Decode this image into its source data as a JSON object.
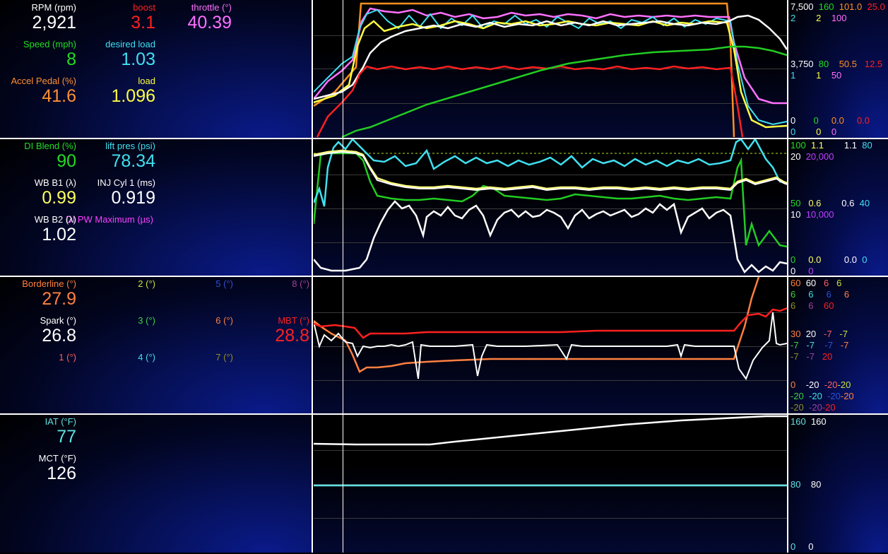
{
  "panel1": {
    "gauges": [
      {
        "label": "RPM (rpm)",
        "value": "2,921",
        "color": "#ffffff"
      },
      {
        "label": "boost",
        "value": "3.1",
        "color": "#ff2020"
      },
      {
        "label": "throttle (°)",
        "value": "40.39",
        "color": "#ff70ff"
      },
      {
        "label": "Speed (mph)",
        "value": "8",
        "color": "#22dd22"
      },
      {
        "label": "desired load",
        "value": "1.03",
        "color": "#40e0f0"
      },
      {
        "label": "Accel Pedal (%)",
        "value": "41.6",
        "color": "#ff9030"
      },
      {
        "label": "load",
        "value": "1.096",
        "color": "#ffff40"
      }
    ],
    "scales": {
      "top": [
        "7,500",
        "160",
        "101.0",
        "25.0",
        "2",
        "2",
        "100"
      ],
      "mid": [
        "3,750",
        "80",
        "50.5",
        "12.5",
        "1",
        "1",
        "50"
      ],
      "bot": [
        "0",
        "0",
        "0.0",
        "0.0",
        "0",
        "0",
        "0"
      ]
    }
  },
  "panel2": {
    "gauges": [
      {
        "label": "DI Blend (%)",
        "value": "90",
        "color": "#22dd22"
      },
      {
        "label": "lift pres (psi)",
        "value": "78.34",
        "color": "#40e0f0"
      },
      {
        "label": "WB B1 (λ)",
        "value": "0.99",
        "color": "#ffff60"
      },
      {
        "label": "INJ Cyl 1 (ms)",
        "value": "0.919",
        "color": "#ffffff"
      },
      {
        "label": "WB B2 (λ)",
        "value": "1.02",
        "color": "#ffffff"
      },
      {
        "label": "DI PW Maximum (µs)",
        "value": "",
        "color": "#ff40ff"
      }
    ],
    "scales": {
      "top": [
        "100",
        "1.1",
        "1.1",
        "80",
        "20",
        "20,000"
      ],
      "mid": [
        "50",
        "0.6",
        "0.6",
        "40",
        "10",
        "10,000"
      ],
      "bot": [
        "0",
        "0.0",
        "0.0",
        "0",
        "0",
        "0"
      ]
    }
  },
  "panel3": {
    "gauges": [
      {
        "label": "Borderline (°)",
        "value": "27.9",
        "color": "#ff8040"
      },
      {
        "label": "2 (°)",
        "value": "",
        "color": "#c8e040"
      },
      {
        "label": "5 (°)",
        "value": "",
        "color": "#3050d0"
      },
      {
        "label": "8 (°)",
        "value": "",
        "color": "#a040a0"
      },
      {
        "label": "Spark (°)",
        "value": "26.8",
        "color": "#ffffff"
      },
      {
        "label": "3 (°)",
        "value": "",
        "color": "#40d040"
      },
      {
        "label": "6 (°)",
        "value": "",
        "color": "#ff8040"
      },
      {
        "label": "MBT (°)",
        "value": "28.8",
        "color": "#ff2020"
      },
      {
        "label": "1 (°)",
        "value": "",
        "color": "#ff6060"
      },
      {
        "label": "4 (°)",
        "value": "",
        "color": "#40e0e0"
      },
      {
        "label": "7 (°)",
        "value": "",
        "color": "#909020"
      }
    ],
    "scales": {
      "r1": [
        "60",
        "60",
        "6",
        "6"
      ],
      "r2": [
        "6",
        "6",
        "6",
        "6"
      ],
      "r3": [
        "6",
        "6",
        "60"
      ],
      "r4": [
        "30",
        "20",
        "-7",
        "-7"
      ],
      "r5": [
        "-7",
        "-7",
        "-7",
        "-7"
      ],
      "r6": [
        "-7",
        "-7",
        "20"
      ],
      "r7": [
        "0",
        "-20",
        "-20",
        "-20"
      ],
      "r8": [
        "-20",
        "-20",
        "-20",
        "-20"
      ],
      "r9": [
        "-20",
        "-20",
        "-20"
      ]
    }
  },
  "panel4": {
    "gauges": [
      {
        "label": "IAT (°F)",
        "value": "77",
        "color": "#60e0e0"
      },
      {
        "label": "MCT (°F)",
        "value": "126",
        "color": "#ffffff"
      }
    ],
    "scales": {
      "top": [
        "160",
        "160"
      ],
      "mid": [
        "80",
        "80"
      ],
      "bot": [
        "0",
        "0"
      ]
    }
  },
  "colors": {
    "white": "#ffffff",
    "red": "#ff2020",
    "orange": "#ff9020",
    "green": "#22cc22",
    "cyan": "#40e0f0",
    "yellow": "#ffff40",
    "pink": "#ff70ff",
    "magenta": "#c040ff"
  }
}
